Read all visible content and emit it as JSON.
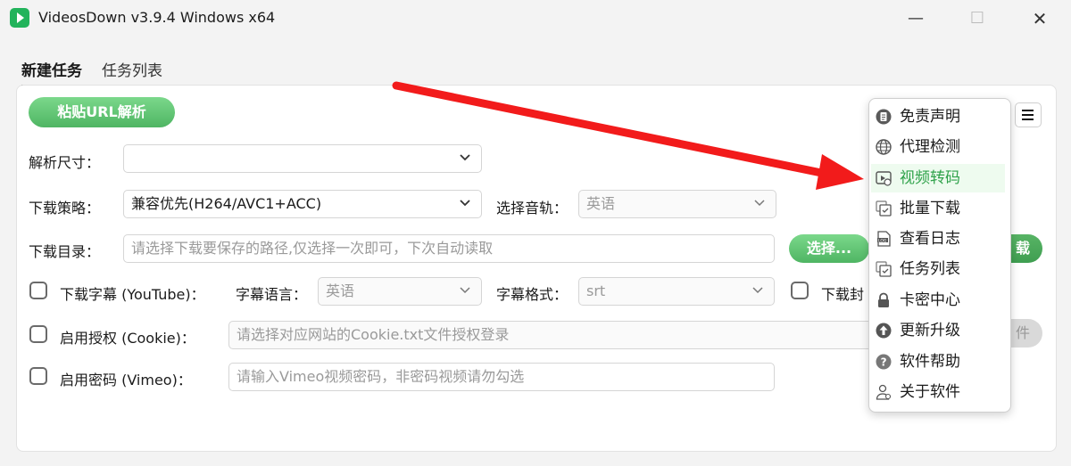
{
  "window": {
    "title": "VideosDown v3.9.4 Windows x64"
  },
  "tabs": {
    "new_task": "新建任务",
    "task_list": "任务列表"
  },
  "toolbar": {
    "paste_button": "粘贴URL解析"
  },
  "form": {
    "resolution_label": "解析尺寸：",
    "resolution_value": "",
    "strategy_label": "下载策略：",
    "strategy_value": "兼容优先(H264/AVC1+ACC)",
    "audio_label": "选择音轨：",
    "audio_value": "英语",
    "dir_label": "下载目录：",
    "dir_placeholder": "请选择下载要保存的路径,仅选择一次即可，下次自动读取",
    "choose_button": "选择...",
    "open_button_partial": "载",
    "subtitle_label": "下载字幕 (YouTube)：",
    "subtitle_lang_label": "字幕语言：",
    "subtitle_lang_value": "英语",
    "subtitle_format_label": "字幕格式：",
    "subtitle_format_value": "srt",
    "cover_label_partial": "下载封",
    "cookie_label": "启用授权 (Cookie)：",
    "cookie_placeholder": "请选择对应网站的Cookie.txt文件授权登录",
    "cookie_button_partial": "件",
    "password_label": "启用密码 (Vimeo)：",
    "password_placeholder": "请输入Vimeo视频密码，非密码视频请勿勾选"
  },
  "menu": {
    "items": [
      {
        "label": "免责声明",
        "icon": "disclaimer-icon"
      },
      {
        "label": "代理检测",
        "icon": "globe-icon"
      },
      {
        "label": "视频转码",
        "icon": "video-convert-icon"
      },
      {
        "label": "批量下载",
        "icon": "batch-icon"
      },
      {
        "label": "查看日志",
        "icon": "log-icon"
      },
      {
        "label": "任务列表",
        "icon": "task-list-icon"
      },
      {
        "label": "卡密中心",
        "icon": "lock-icon"
      },
      {
        "label": "更新升级",
        "icon": "upgrade-icon"
      },
      {
        "label": "软件帮助",
        "icon": "help-icon"
      },
      {
        "label": "关于软件",
        "icon": "user-icon"
      }
    ],
    "active_index": 2
  },
  "colors": {
    "accent": "#4fb563",
    "annotation": "#f21b1b"
  }
}
